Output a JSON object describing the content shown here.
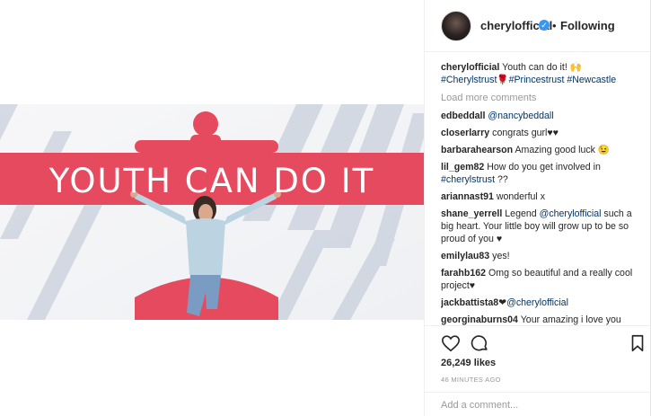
{
  "post": {
    "username": "cherylofficial",
    "follow_status": "Following",
    "separator": "•",
    "photo_text": "YOUTH CAN DO IT"
  },
  "caption": {
    "user": "cherylofficial",
    "text": "Youth can do it! 🙌",
    "hashtags": "#Cherylstrust🌹#Princestrust #Newcastle"
  },
  "load_more": "Load more comments",
  "comments": [
    {
      "user": "edbeddall",
      "mention": "@nancybeddall",
      "text": ""
    },
    {
      "user": "closerlarry",
      "mention": "",
      "text": "congrats gurl♥♥"
    },
    {
      "user": "barbarahearson",
      "mention": "",
      "text": "Amazing good luck 😉"
    },
    {
      "user": "lil_gem82",
      "mention": "",
      "text": "How do you get involved in",
      "hashtag": "#cherylstrust",
      "suffix": " ??"
    },
    {
      "user": "ariannast91",
      "mention": "",
      "text": "wonderful x"
    },
    {
      "user": "shane_yerrell",
      "text_before": "Legend",
      "mention": "@cherylofficial",
      "text": " such a big heart. Your little boy will grow up to be so proud of you ♥"
    },
    {
      "user": "emilylau83",
      "mention": "",
      "text": "yes!"
    },
    {
      "user": "farahb162",
      "mention": "",
      "text": "Omg so beautiful and a really cool project♥"
    },
    {
      "user": "jackbattista8",
      "text_before": "❤",
      "mention": "@cherylofficial",
      "text": ""
    },
    {
      "user": "georginaburns04",
      "mention": "",
      "text": "Your amazing i love you"
    }
  ],
  "stats": {
    "likes": "26,249 likes",
    "time": "46 MINUTES AGO"
  },
  "add_comment": {
    "placeholder": "Add a comment..."
  },
  "icons": {
    "like": "heart-icon",
    "comment": "comment-icon",
    "save": "bookmark-icon"
  },
  "colors": {
    "link": "#003569",
    "verified": "#3897f0",
    "banner": "#e64a5f"
  }
}
